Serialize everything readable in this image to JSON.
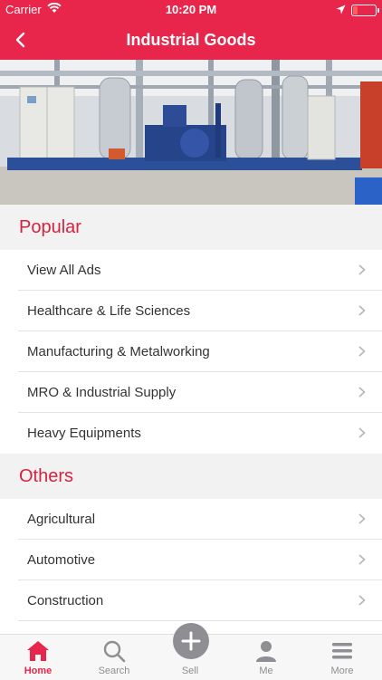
{
  "status_bar": {
    "carrier": "Carrier",
    "time": "10:20 PM",
    "battery_level": 0.2,
    "battery_color": "#ff5d5d"
  },
  "nav": {
    "title": "Industrial Goods",
    "back_icon": "chevron-left-icon"
  },
  "hero": {
    "image": "industrial-machinery-photo"
  },
  "sections": {
    "popular": {
      "title": "Popular",
      "items": [
        "View All Ads",
        "Healthcare & Life Sciences",
        "Manufacturing & Metalworking",
        "MRO & Industrial Supply",
        "Heavy Equipments"
      ]
    },
    "others": {
      "title": "Others",
      "items": [
        "Agricultural",
        "Automotive",
        "Construction"
      ]
    }
  },
  "tabbar": {
    "tabs": [
      {
        "label": "Home",
        "icon": "home-icon",
        "active": true
      },
      {
        "label": "Search",
        "icon": "search-icon",
        "active": false
      },
      {
        "label": "Sell",
        "icon": "plus-icon",
        "active": false
      },
      {
        "label": "Me",
        "icon": "person-icon",
        "active": false
      },
      {
        "label": "More",
        "icon": "menu-icon",
        "active": false
      }
    ]
  },
  "colors": {
    "brand": "#e8254a",
    "section_title": "#d8213f",
    "inactive_tab": "#8e8e93"
  }
}
